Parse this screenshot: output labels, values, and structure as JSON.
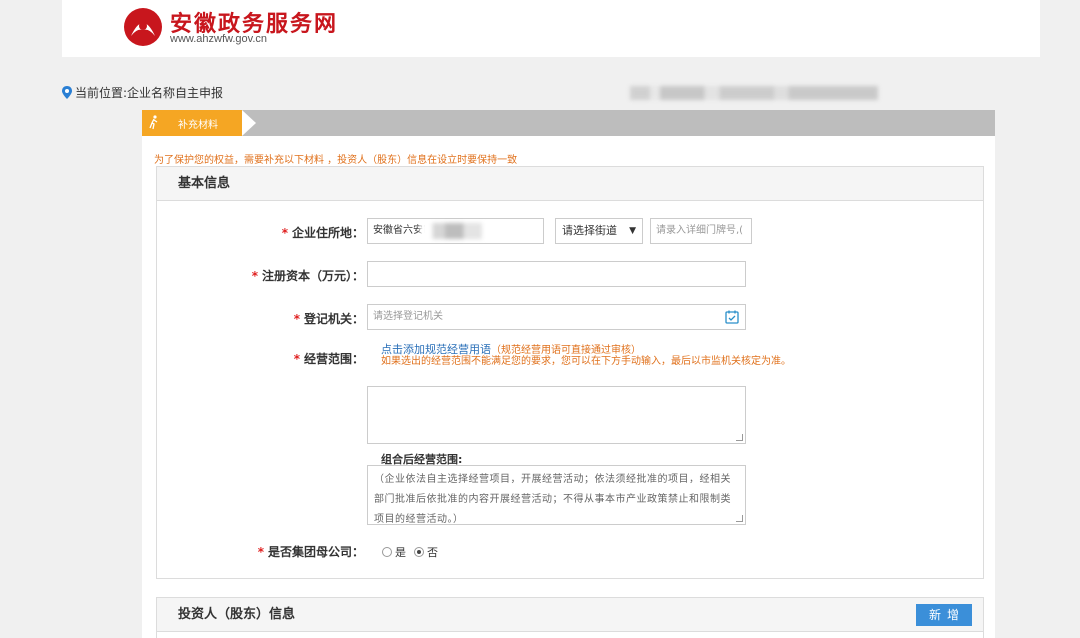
{
  "header": {
    "site_title": "安徽政务服务网",
    "site_url": "www.ahzwfw.gov.cn",
    "brand_color": "#c8161d",
    "logo_icon": "ahzwfw-logo-icon"
  },
  "location": {
    "icon": "location-pin-icon",
    "label": "当前位置:",
    "value": "企业名称自主申报"
  },
  "steps": {
    "active_label": "补充材料",
    "active_color": "#f5a623",
    "active_icon": "walking-person-icon"
  },
  "notice": "为了保护您的权益，需要补充以下材料 ，投资人（股东）信息在设立时要保持一致",
  "basic_info": {
    "title": "基本信息",
    "address": {
      "label": "企业住所地：",
      "value": "安徽省六安i",
      "street_select": "请选择街道",
      "detail_placeholder": "请录入详细门牌号,("
    },
    "capital": {
      "label": "注册资本（万元）：",
      "value": ""
    },
    "authority": {
      "label": "登记机关：",
      "placeholder": "请选择登记机关",
      "icon": "select-dialog-icon"
    },
    "scope": {
      "label": "经营范围：",
      "link": "点击添加规范经营用语",
      "link_hint": "（规范经营用语可直接通过审核）",
      "warning": "如果选出的经营范围不能满足您的要求，您可以在下方手动输入，最后以市监机关核定为准。",
      "combined_label": "组合后经营范围:",
      "combined_text": "（企业依法自主选择经营项目，开展经营活动；依法须经批准的项目，经相关部门批准后依批准的内容开展经营活动；不得从事本市产业政策禁止和限制类项目的经营活动。）"
    },
    "group_parent": {
      "label": "是否集团母公司：",
      "options": [
        "是",
        "否"
      ],
      "selected": "否"
    }
  },
  "investor": {
    "title": "投资人（股东）信息",
    "add_button": "新增",
    "button_color": "#3b8fd9"
  },
  "required_mark": "*"
}
